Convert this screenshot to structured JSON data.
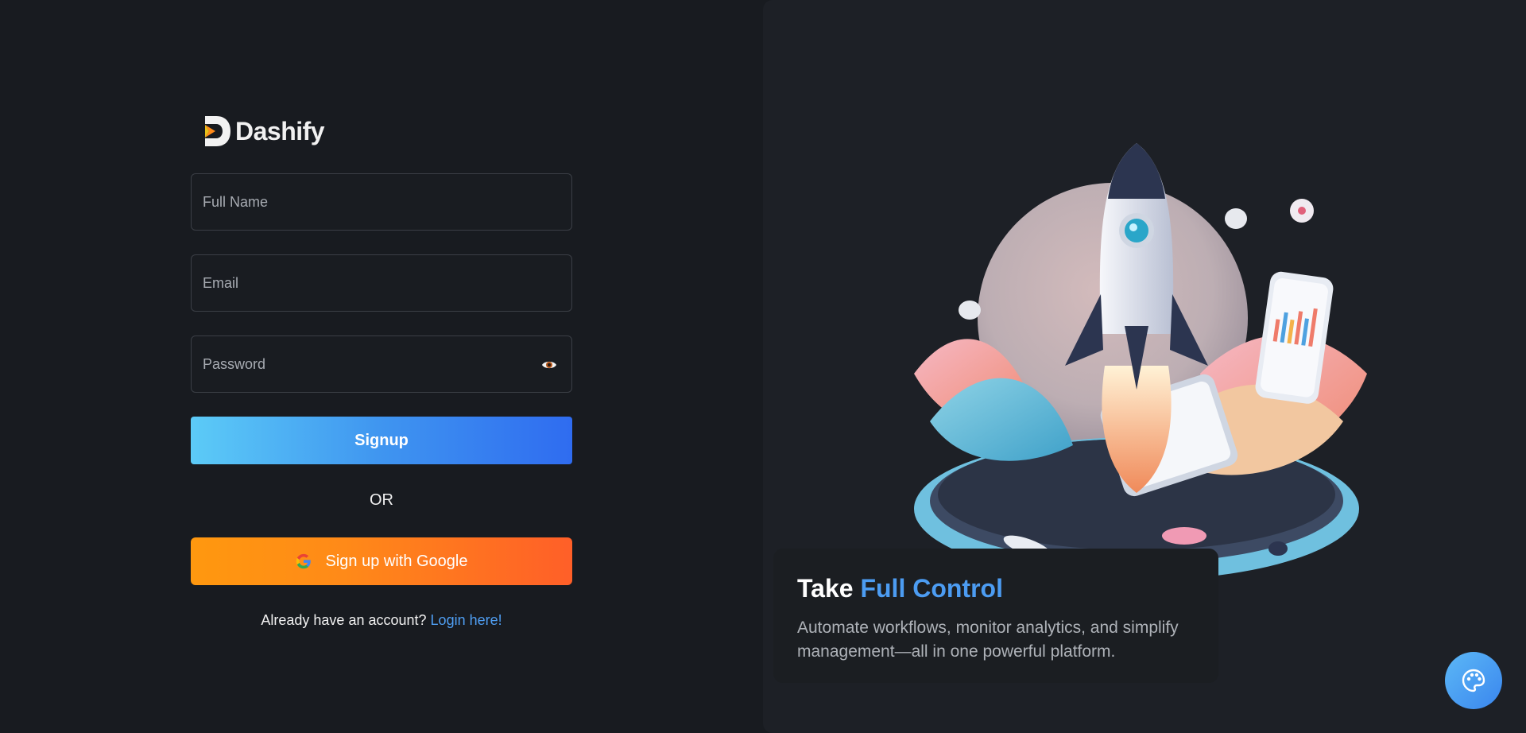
{
  "brand": {
    "name": "Dashify",
    "logo_icon": "dashify-logo-icon"
  },
  "form": {
    "full_name_placeholder": "Full Name",
    "email_placeholder": "Email",
    "password_placeholder": "Password",
    "password_toggle_icon": "eye-icon",
    "signup_label": "Signup",
    "or_label": "OR",
    "google_label": "Sign up with Google",
    "google_icon": "google-icon",
    "login_prompt": "Already have an account?",
    "login_link": "Login here!"
  },
  "hero": {
    "title_prefix": "Take ",
    "title_accent": "Full Control",
    "description": "Automate workflows, monitor analytics, and simplify management—all in one powerful platform."
  },
  "fab": {
    "icon": "palette-icon"
  },
  "colors": {
    "background": "#181b20",
    "panel": "#1d2026",
    "accent_blue": "#4c9cf2",
    "signup_gradient_start": "#5ccbf7",
    "signup_gradient_end": "#2f6cf0",
    "google_gradient_start": "#ff980f",
    "google_gradient_end": "#ff5f28"
  }
}
